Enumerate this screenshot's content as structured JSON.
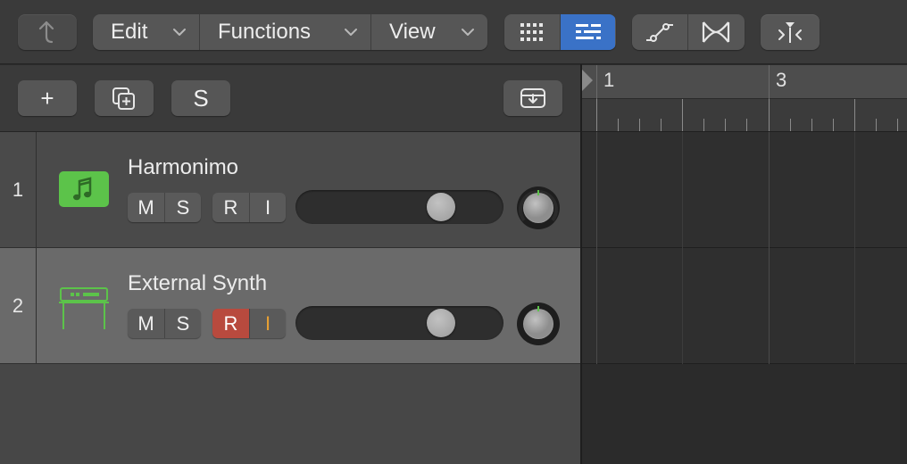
{
  "toolbar": {
    "back_icon": "up-arrow-icon",
    "menus": [
      {
        "label": "Edit"
      },
      {
        "label": "Functions"
      },
      {
        "label": "View"
      }
    ],
    "view_toggle": {
      "grid_icon": "grid-view-icon",
      "list_icon": "list-view-icon",
      "active": "list"
    },
    "automation_icon": "automation-curve-icon",
    "flex_icon": "flex-time-icon",
    "catch_icon": "catch-playhead-icon"
  },
  "track_header": {
    "add_label": "+",
    "duplicate_icon": "duplicate-track-icon",
    "solo_label": "S",
    "download_icon": "download-tray-icon"
  },
  "tracks": [
    {
      "number": "1",
      "name": "Harmonimo",
      "icon": "music-note-icon",
      "icon_color": "#5cc34a",
      "mute": "M",
      "solo": "S",
      "record": "R",
      "input": "I",
      "record_enabled": false,
      "input_enabled": false,
      "volume_fraction": 0.73,
      "pan": 0
    },
    {
      "number": "2",
      "name": "External Synth",
      "icon": "keyboard-stand-icon",
      "icon_color": "#5cc34a",
      "mute": "M",
      "solo": "S",
      "record": "R",
      "input": "I",
      "record_enabled": true,
      "input_enabled": true,
      "volume_fraction": 0.73,
      "pan": 0
    }
  ],
  "ruler": {
    "bars": [
      "1",
      "3"
    ]
  },
  "colors": {
    "accent": "#3a72c7",
    "record": "#b84a3e",
    "input": "#e8a033",
    "track_icon": "#5cc34a"
  }
}
